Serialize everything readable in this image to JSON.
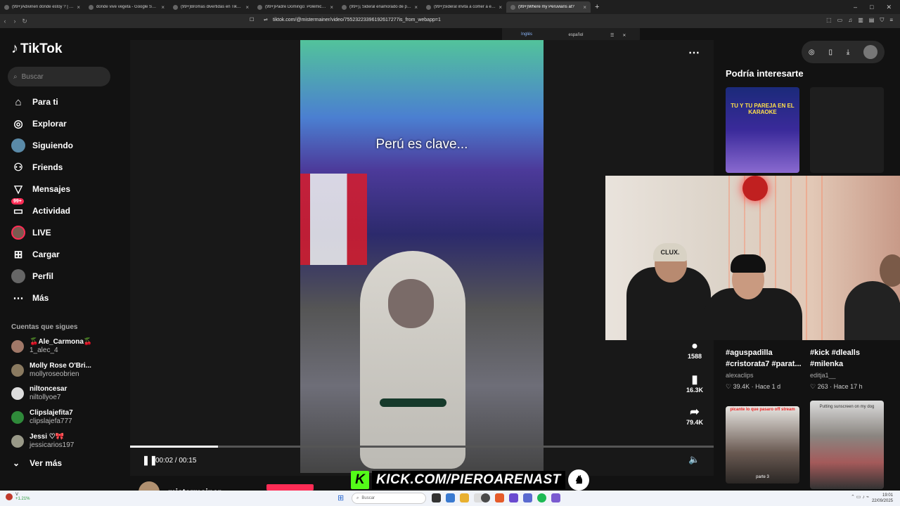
{
  "browser": {
    "tabs": [
      {
        "label": "(99+)Adivinen dónde estoy ? | rosan",
        "active": false
      },
      {
        "label": "donde vive vegeta - Google Search",
        "active": false
      },
      {
        "label": "(99+)Bromas divertidas en TikTok co",
        "active": false
      },
      {
        "label": "(99+)Padre Domingo: Polémicas y C",
        "active": false
      },
      {
        "label": "(99+)¡ Sideral enamorado de patito",
        "active": false
      },
      {
        "label": "(99+)Sideral invita a comer a emeteo",
        "active": false
      },
      {
        "label": "(99+)Where my Peruvians at?",
        "active": true
      }
    ],
    "new_tab": "+",
    "url": "tiktok.com/@mistermainer/video/75523223396192617277is_from_webapp=1",
    "translate": {
      "from": "Inglés",
      "to": "español"
    }
  },
  "sidebar": {
    "logo": "TikTok",
    "search_placeholder": "Buscar",
    "menu": [
      {
        "label": "Para ti",
        "icon": "home-icon"
      },
      {
        "label": "Explorar",
        "icon": "compass-icon"
      },
      {
        "label": "Siguiendo",
        "icon": "following-avatar-icon"
      },
      {
        "label": "Friends",
        "icon": "friends-icon"
      },
      {
        "label": "Mensajes",
        "icon": "messages-icon"
      },
      {
        "label": "Actividad",
        "icon": "activity-icon",
        "badge": "99+"
      },
      {
        "label": "LIVE",
        "icon": "live-icon"
      },
      {
        "label": "Cargar",
        "icon": "upload-icon"
      },
      {
        "label": "Perfil",
        "icon": "profile-icon"
      },
      {
        "label": "Más",
        "icon": "more-icon"
      }
    ],
    "following_title": "Cuentas que sigues",
    "following": [
      {
        "name": "🍒Ale_Carmona🍒",
        "user": "1_alec_4"
      },
      {
        "name": "Molly Rose O'Bri...",
        "user": "mollyroseobrien"
      },
      {
        "name": "niltoncesar",
        "user": "niltollyoe7"
      },
      {
        "name": "Clipslajefita7",
        "user": "clipslajefa777"
      },
      {
        "name": "Jessi ♡🎀",
        "user": "jessicarios197"
      }
    ],
    "see_more": "Ver más"
  },
  "player": {
    "caption": "Perú es clave...",
    "time": "00:02 / 00:15",
    "progress": 0.15,
    "actions": [
      {
        "icon": "comment-icon",
        "count": "1588"
      },
      {
        "icon": "bookmark-icon",
        "count": "16.3K"
      },
      {
        "icon": "share-icon",
        "count": "79.4K"
      }
    ],
    "author": "mistermainer"
  },
  "recommended": {
    "title": "Podría interesarte",
    "cards": [
      {
        "title": "#aguspadilla #cristorata7 #parat...",
        "user": "alexaclips",
        "stats": "♡ 39.4K · Hace 1 d"
      },
      {
        "title": "#kick #dlealls #milenka",
        "user": "editja1__",
        "stats": "♡ 263 · Hace 17 h"
      }
    ],
    "thumb_captions": [
      "TU Y TU PAREJA EN EL KARAOKE",
      "picante lo que pasaro off stream",
      "Putting sunscreen on my dog",
      "parte 3"
    ]
  },
  "stream": {
    "kick_text": "KICK.COM/PIEROARENAST",
    "cap_text": "CLUX."
  },
  "taskbar": {
    "search_placeholder": "Buscar",
    "weather_label": "V",
    "weather_value": "+1.21%",
    "time": "19:01",
    "date": "22/09/2025"
  }
}
